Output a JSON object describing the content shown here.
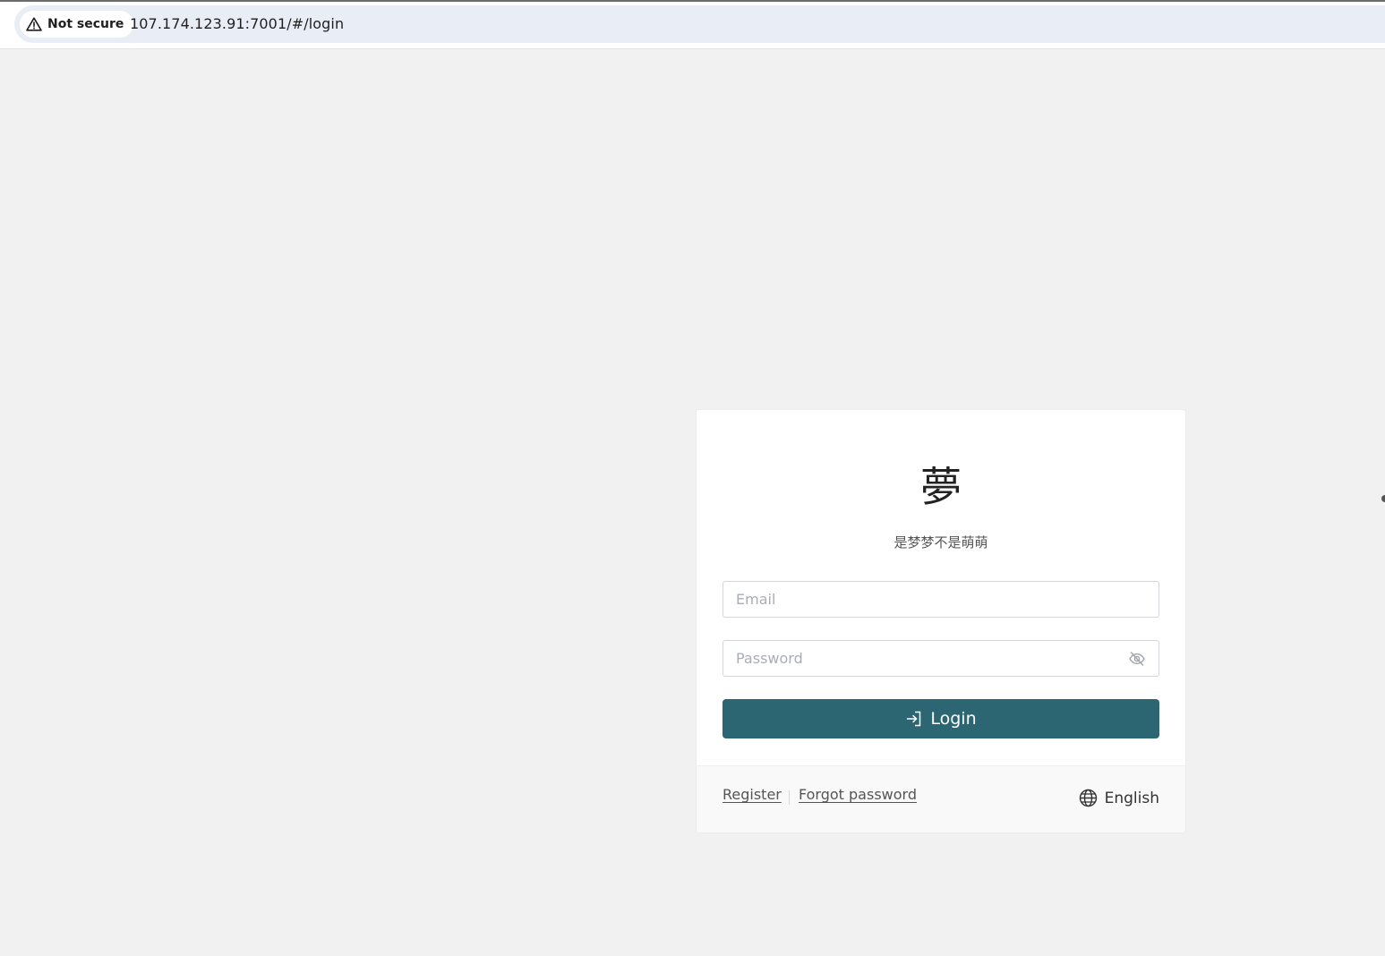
{
  "browser": {
    "security_label": "Not secure",
    "url": "107.174.123.91:7001/#/login"
  },
  "login_card": {
    "logo_text": "夢",
    "tagline": "是梦梦不是萌萌",
    "email": {
      "placeholder": "Email",
      "value": ""
    },
    "password": {
      "placeholder": "Password",
      "value": ""
    },
    "login_label": "Login",
    "footer": {
      "register_label": "Register",
      "forgot_label": "Forgot password",
      "language_label": "English"
    }
  },
  "colors": {
    "page_background": "#f1f1f1",
    "primary_button": "#2c6672",
    "card_background": "#ffffff"
  },
  "icons": {
    "security": "warning-triangle-icon",
    "password_toggle": "eye-off-icon",
    "login": "sign-in-icon",
    "language": "globe-icon"
  }
}
